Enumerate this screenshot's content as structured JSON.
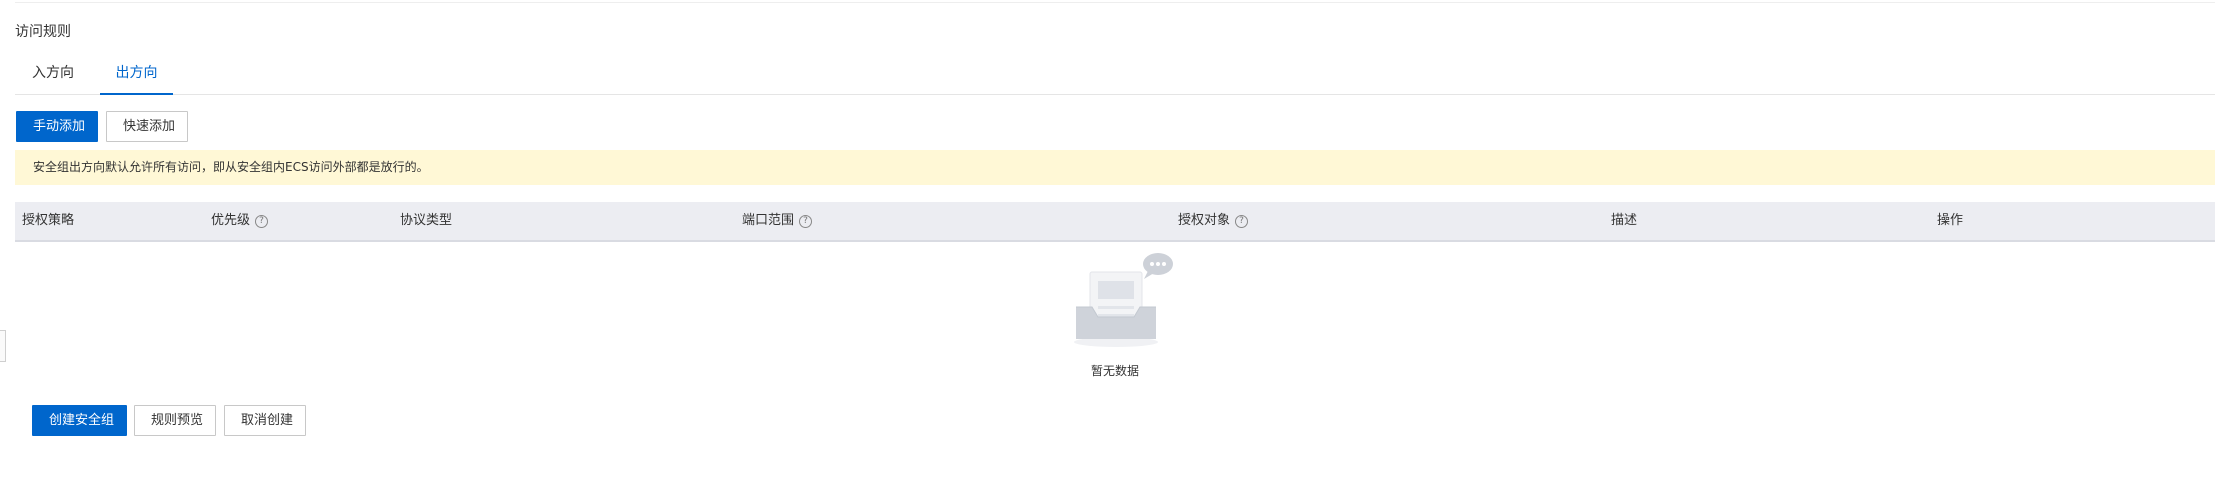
{
  "section": {
    "title": "访问规则"
  },
  "tabs": [
    {
      "label": "入方向",
      "active": false
    },
    {
      "label": "出方向",
      "active": true
    }
  ],
  "toolbar": {
    "manual_add": "手动添加",
    "quick_add": "快速添加"
  },
  "notice": {
    "text": "安全组出方向默认允许所有访问，即从安全组内ECS访问外部都是放行的。"
  },
  "table": {
    "columns": [
      {
        "label": "授权策略",
        "help": false
      },
      {
        "label": "优先级",
        "help": true
      },
      {
        "label": "协议类型",
        "help": false
      },
      {
        "label": "端口范围",
        "help": true
      },
      {
        "label": "授权对象",
        "help": true
      },
      {
        "label": "描述",
        "help": false
      },
      {
        "label": "操作",
        "help": false
      }
    ],
    "empty_text": "暂无数据"
  },
  "footer": {
    "create": "创建安全组",
    "preview": "规则预览",
    "cancel": "取消创建"
  },
  "colors": {
    "primary": "#0066cc",
    "notice_bg": "#fff8d6",
    "header_bg": "#ecedf2"
  }
}
